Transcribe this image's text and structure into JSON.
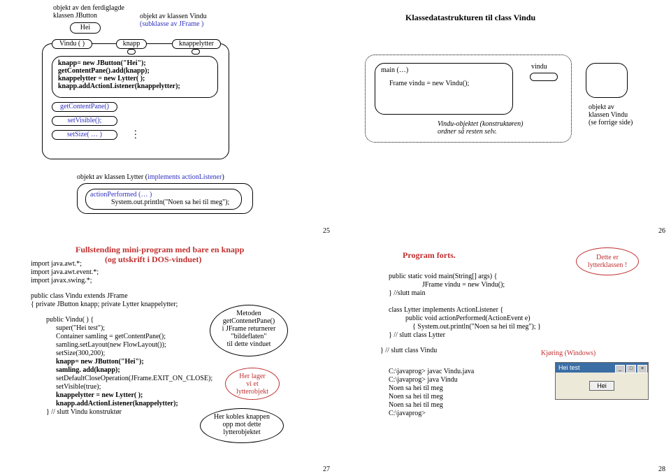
{
  "q1": {
    "caption_obj_btn1": "objekt av den ferdiglagde",
    "caption_obj_btn2": "klassen JButton",
    "hei": "Hei",
    "caption_obj_vindu": "objekt av klassen Vindu",
    "caption_obj_vindu_sub": "(subklasse av JFrame )",
    "vindu_ctor": "Vindu ( )",
    "knapp": "knapp",
    "knappelytter": "knappelytter",
    "line1": "knapp= new JButton(\"Hei\");",
    "line2": "getContentPane().add(knapp);",
    "line3": "knappelytter = new Lytter( );",
    "line4": "knapp.addActionListener(knappelytter);",
    "gcp": "getContentPane()",
    "sv": "setVisible();",
    "ss": "setSize( … )",
    "dots": ". . .",
    "lytter_caption": "objekt av klassen Lytter (",
    "lytter_caption_impl": "implements actionListener",
    "lytter_caption_close": ")",
    "ap": "actionPerformed (… )",
    "sop": "System.out.println(\"Noen sa hei til meg\");",
    "page": "25"
  },
  "q2": {
    "title": "Klassedatastrukturen til class Vindu",
    "main": "main  (…)",
    "frame_line": "Frame vindu = new Vindu();",
    "vindu": "vindu",
    "kon1": "Vindu-objektet (konstruktøren)",
    "kon2": "ordner så resten selv.",
    "obj1": "objekt av",
    "obj2": "klassen Vindu",
    "obj3": "(se forrige side)",
    "page": "26"
  },
  "q3": {
    "title1": "Fullstending mini-program med bare en knapp",
    "title2": "(og utskrift i DOS-vinduet)",
    "imp1": "import java.awt.*;",
    "imp2": "import java.awt.event.*;",
    "imp3": "import javax.swing.*;",
    "cls1": "public class Vindu extends JFrame",
    "cls2": "{ private JButton knapp;   private Lytter knappelytter;",
    "m1": "public Vindu( )  {",
    "m2": "super(\"Hei test\");",
    "m3": "Container samling = getContentPane();",
    "m4": "samling.setLayout(new FlowLayout());",
    "m5": "setSize(300,200);",
    "m6": "knapp= new JButton(\"Hei\");",
    "m7": "samling. add(knapp);",
    "m8": "setDefaultCloseOperation(JFrame.EXIT_ON_CLOSE);",
    "m9": "setVisible(true);",
    "m10": "knappelytter = new Lytter( );",
    "m11": "knapp.addActionListener(knappelytter);",
    "m12": "} // slutt Vindu konstruktør",
    "b1a": "Metoden",
    "b1b": "getContenetPane()",
    "b1c": "i JFrame returnerer",
    "b1d": "\"bildeflaten\"",
    "b1e": "til dette vinduet",
    "b2a": "Her lager",
    "b2b": "vi et",
    "b2c": "lytterobjekt",
    "b3a": "Her kobles knappen",
    "b3b": "opp mot dette",
    "b3c": "lytterobjektet",
    "page": "27"
  },
  "q4": {
    "title": "Program forts.",
    "p1": "public static void main(String[] args)  {",
    "p2": "JFrame vindu = new Vindu();",
    "p3": "} //slutt main",
    "p4": "class Lytter implements ActionListener {",
    "p5": "public void actionPerformed(ActionEvent e)",
    "p6": "{  System.out.println(\"Noen sa hei til meg\"); }",
    "p7": "} // slutt class Lytter",
    "p8": "} // slutt class Vindu",
    "k": "Kjøring (Windows)",
    "c1": "C:\\javaprog> javac Vindu.java",
    "c2": "C:\\javaprog> java Vindu",
    "c3": "Noen sa hei til meg",
    "c4": "Noen sa hei til meg",
    "c5": "Noen sa hei til meg",
    "c6": "C:\\javaprog>",
    "note1": "Dette er",
    "note2": "lytterklassen !",
    "win_title": "Hei test",
    "win_btn": "Hei",
    "page": "28"
  }
}
